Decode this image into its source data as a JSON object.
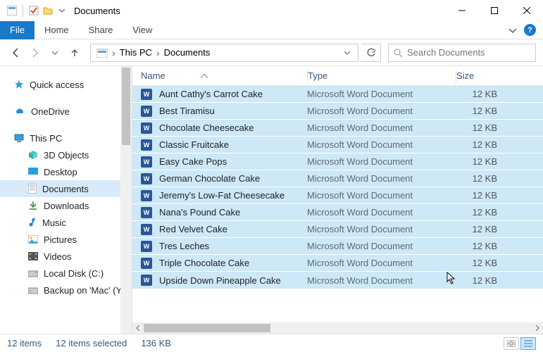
{
  "titlebar": {
    "title": "Documents"
  },
  "ribbon": {
    "file": "File",
    "home": "Home",
    "share": "Share",
    "view": "View"
  },
  "address": {
    "segments": [
      "This PC",
      "Documents"
    ],
    "search_placeholder": "Search Documents"
  },
  "nav": {
    "quick_access": "Quick access",
    "onedrive": "OneDrive",
    "this_pc": "This PC",
    "children": [
      {
        "label": "3D Objects"
      },
      {
        "label": "Desktop"
      },
      {
        "label": "Documents"
      },
      {
        "label": "Downloads"
      },
      {
        "label": "Music"
      },
      {
        "label": "Pictures"
      },
      {
        "label": "Videos"
      },
      {
        "label": "Local Disk (C:)"
      },
      {
        "label": "Backup on 'Mac' (Y:)"
      }
    ]
  },
  "columns": {
    "name": "Name",
    "type": "Type",
    "size": "Size"
  },
  "files": [
    {
      "name": "Aunt Cathy's Carrot Cake",
      "type": "Microsoft Word Document",
      "size": "12 KB"
    },
    {
      "name": "Best Tiramisu",
      "type": "Microsoft Word Document",
      "size": "12 KB"
    },
    {
      "name": "Chocolate Cheesecake",
      "type": "Microsoft Word Document",
      "size": "12 KB"
    },
    {
      "name": "Classic Fruitcake",
      "type": "Microsoft Word Document",
      "size": "12 KB"
    },
    {
      "name": "Easy Cake Pops",
      "type": "Microsoft Word Document",
      "size": "12 KB"
    },
    {
      "name": "German Chocolate Cake",
      "type": "Microsoft Word Document",
      "size": "12 KB"
    },
    {
      "name": "Jeremy's Low-Fat Cheesecake",
      "type": "Microsoft Word Document",
      "size": "12 KB"
    },
    {
      "name": "Nana's Pound Cake",
      "type": "Microsoft Word Document",
      "size": "12 KB"
    },
    {
      "name": "Red Velvet Cake",
      "type": "Microsoft Word Document",
      "size": "12 KB"
    },
    {
      "name": "Tres Leches",
      "type": "Microsoft Word Document",
      "size": "12 KB"
    },
    {
      "name": "Triple Chocolate Cake",
      "type": "Microsoft Word Document",
      "size": "12 KB"
    },
    {
      "name": "Upside Down Pineapple Cake",
      "type": "Microsoft Word Document",
      "size": "12 KB"
    }
  ],
  "status": {
    "count": "12 items",
    "selected": "12 items selected",
    "size": "136 KB"
  }
}
